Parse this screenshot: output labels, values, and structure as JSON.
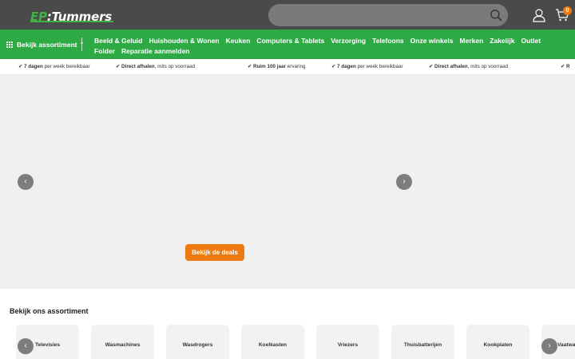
{
  "header": {
    "logo_prefix": "EP",
    "logo_dash": ":",
    "logo_name": "Tummers",
    "search_placeholder": "",
    "cart_count": "0"
  },
  "nav": {
    "assortment_label": "Bekijk assortiment",
    "links": [
      "Beeld & Geluid",
      "Huishouden & Wonen",
      "Keuken",
      "Computers & Tablets",
      "Verzorging",
      "Telefoons",
      "Onze winkels",
      "Merken",
      "Zakelijk",
      "Outlet",
      "Folder",
      "Reparatie aanmelden"
    ]
  },
  "usps": [
    {
      "check": "✔",
      "bold": "7 dagen",
      "rest": " per week bereikbaar"
    },
    {
      "check": "✔",
      "bold": "Direct afhalen",
      "rest": ", mits op voorraad"
    },
    {
      "check": "✔",
      "bold": "Ruim 100 jaar",
      "rest": " ervaring"
    },
    {
      "check": "✔",
      "bold": "7 dagen",
      "rest": " per week bereikbaar"
    },
    {
      "check": "✔",
      "bold": "Direct afhalen",
      "rest": ", mits op voorraad"
    },
    {
      "check": "✔",
      "bold": "R",
      "rest": ""
    }
  ],
  "hero": {
    "cta_label": "Bekijk de deals",
    "prev_symbol": "‹",
    "next_symbol": "›"
  },
  "assortment": {
    "title": "Bekijk ons assortiment",
    "categories": [
      "Televisies",
      "Wasmachines",
      "Wasdrogers",
      "Koelkasten",
      "Vriezers",
      "Thuisbatterijen",
      "Kookplaten",
      "Vaatwassers"
    ]
  },
  "colors": {
    "header_bg": "#4a4a4a",
    "nav_green": "#2eaa45",
    "accent_orange": "#f07a12"
  }
}
